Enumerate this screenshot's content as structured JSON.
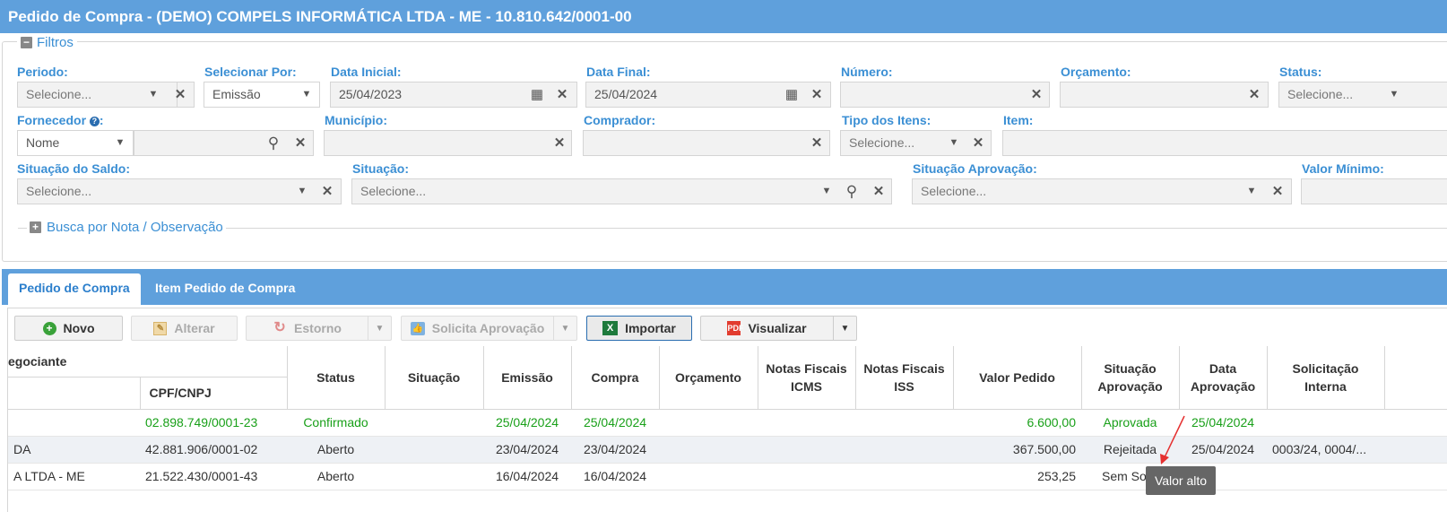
{
  "window": {
    "title": "Pedido de Compra - (DEMO) COMPELS INFORMÁTICA LTDA - ME - 10.810.642/0001-00"
  },
  "filters": {
    "legend": "Filtros",
    "periodo": {
      "label": "Periodo:",
      "placeholder": "Selecione..."
    },
    "selecionar_por": {
      "label": "Selecionar Por:",
      "value": "Emissão"
    },
    "data_inicial": {
      "label": "Data Inicial:",
      "value": "25/04/2023"
    },
    "data_final": {
      "label": "Data Final:",
      "value": "25/04/2024"
    },
    "numero": {
      "label": "Número:",
      "value": ""
    },
    "orcamento": {
      "label": "Orçamento:",
      "value": ""
    },
    "status": {
      "label": "Status:",
      "placeholder": "Selecione..."
    },
    "fornecedor": {
      "label": "Fornecedor",
      "type_value": "Nome",
      "value": ""
    },
    "municipio": {
      "label": "Município:",
      "value": ""
    },
    "comprador": {
      "label": "Comprador:",
      "value": ""
    },
    "tipo_itens": {
      "label": "Tipo dos Itens:",
      "placeholder": "Selecione..."
    },
    "item": {
      "label": "Item:",
      "value": ""
    },
    "situacao_saldo": {
      "label": "Situação do Saldo:",
      "placeholder": "Selecione..."
    },
    "situacao": {
      "label": "Situação:",
      "placeholder": "Selecione..."
    },
    "situacao_aprovacao": {
      "label": "Situação Aprovação:",
      "placeholder": "Selecione..."
    },
    "valor_minimo": {
      "label": "Valor Mínimo:",
      "value": ""
    },
    "busca_nota": "Busca por Nota / Observação"
  },
  "tabs": [
    {
      "label": "Pedido de Compra",
      "active": true
    },
    {
      "label": "Item Pedido de Compra",
      "active": false
    }
  ],
  "toolbar": {
    "novo": "Novo",
    "alterar": "Alterar",
    "estorno": "Estorno",
    "solicita_aprovacao": "Solicita Aprovação",
    "importar": "Importar",
    "visualizar": "Visualizar"
  },
  "grid": {
    "group_header": "egociante",
    "columns": {
      "cpf_cnpj": "CPF/CNPJ",
      "status": "Status",
      "situacao": "Situação",
      "emissao": "Emissão",
      "compra": "Compra",
      "orcamento": "Orçamento",
      "nf_icms": [
        "Notas Fiscais",
        "ICMS"
      ],
      "nf_iss": [
        "Notas Fiscais",
        "ISS"
      ],
      "valor_pedido": "Valor Pedido",
      "situacao_aprovacao": [
        "Situação",
        "Aprovação"
      ],
      "data_aprovacao": [
        "Data",
        "Aprovação"
      ],
      "solicitacao_interna": [
        "Solicitação",
        "Interna"
      ]
    },
    "rows": [
      {
        "name": "",
        "cnpj": "02.898.749/0001-23",
        "status": "Confirmado",
        "situacao": "",
        "emissao": "25/04/2024",
        "compra": "25/04/2024",
        "orcamento": "",
        "nf_icms": "",
        "nf_iss": "",
        "valor": "6.600,00",
        "sit_aprov": "Aprovada",
        "data_aprov": "25/04/2024",
        "solic": ""
      },
      {
        "name": "DA",
        "cnpj": "42.881.906/0001-02",
        "status": "Aberto",
        "situacao": "",
        "emissao": "23/04/2024",
        "compra": "23/04/2024",
        "orcamento": "",
        "nf_icms": "",
        "nf_iss": "",
        "valor": "367.500,00",
        "sit_aprov": "Rejeitada",
        "data_aprov": "25/04/2024",
        "solic": "0003/24, 0004/..."
      },
      {
        "name": "A LTDA - ME",
        "cnpj": "21.522.430/0001-43",
        "status": "Aberto",
        "situacao": "",
        "emissao": "16/04/2024",
        "compra": "16/04/2024",
        "orcamento": "",
        "nf_icms": "",
        "nf_iss": "",
        "valor": "253,25",
        "sit_aprov": "Sem Solic",
        "data_aprov": "",
        "solic": ""
      }
    ]
  },
  "tooltip": "Valor alto",
  "colors": {
    "header_blue": "#5fa0dc",
    "label_blue": "#3b8fd4",
    "green": "#19a019",
    "arrow_red": "#e53030"
  }
}
